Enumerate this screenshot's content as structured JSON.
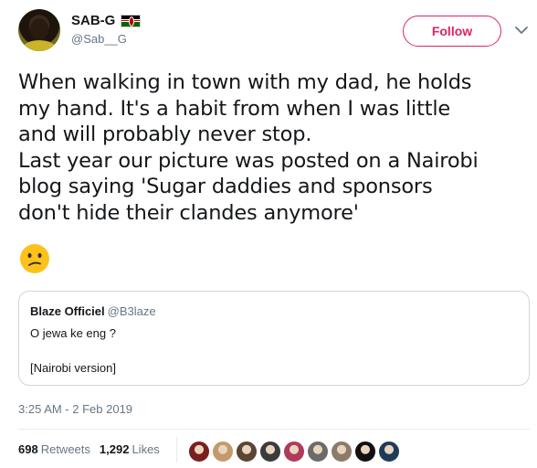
{
  "author": {
    "display_name": "SAB-G",
    "handle": "@Sab__G",
    "flag_icon": "kenya-flag-icon"
  },
  "follow": {
    "label": "Follow",
    "color": "#e0245e"
  },
  "tweet": {
    "lines": [
      "When walking in town with my dad, he holds",
      "my hand. It's a habit from when I was little",
      "and will probably never stop.",
      "Last year our picture was posted on a Nairobi",
      "blog saying 'Sugar daddies and sponsors",
      "don't hide their clandes anymore'"
    ],
    "emoji": "confused-face-emoji"
  },
  "quote": {
    "name": "Blaze Officiel",
    "handle": "@B3laze",
    "line1": "O jewa ke eng ?",
    "line2": "[Nairobi version]"
  },
  "timestamp": "3:25 AM - 2 Feb 2019",
  "stats": {
    "retweets_count": "698",
    "retweets_label": "Retweets",
    "likes_count": "1,292",
    "likes_label": "Likes"
  },
  "likers": [
    {
      "color": "#7a1e1e"
    },
    {
      "color": "#c49a6c"
    },
    {
      "color": "#5a4632"
    },
    {
      "color": "#3b3b3b"
    },
    {
      "color": "#b03a5b"
    },
    {
      "color": "#6b6b6b"
    },
    {
      "color": "#8c7b6b"
    },
    {
      "color": "#111111"
    },
    {
      "color": "#1f3b57"
    }
  ]
}
